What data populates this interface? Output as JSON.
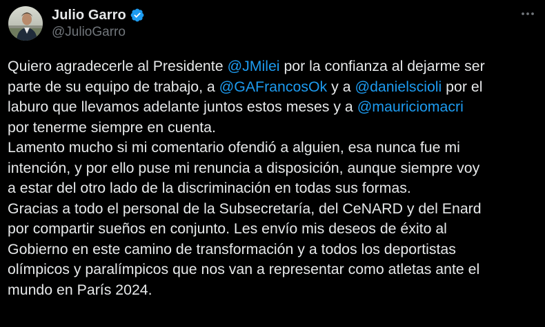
{
  "author": {
    "display_name": "Julio Garro",
    "handle": "@JulioGarro",
    "verified_icon": "verified-badge-icon",
    "avatar_icon": "avatar"
  },
  "menu": {
    "more_icon": "more-options-icon"
  },
  "post": {
    "lines": [
      [
        {
          "text": "Quiero agradecerle al Presidente "
        },
        {
          "text": "@JMilei",
          "mention": true
        },
        {
          "text": " por la confianza al dejarme ser"
        }
      ],
      [
        {
          "text": "parte de su equipo de trabajo, a "
        },
        {
          "text": "@GAFrancosOk",
          "mention": true
        },
        {
          "text": " y a "
        },
        {
          "text": "@danielscioli",
          "mention": true
        },
        {
          "text": " por el"
        }
      ],
      [
        {
          "text": "laburo que llevamos adelante juntos estos meses y a "
        },
        {
          "text": "@mauriciomacri",
          "mention": true
        }
      ],
      [
        {
          "text": "por tenerme siempre en cuenta."
        }
      ],
      [
        {
          "text": "Lamento mucho si mi comentario ofendió a alguien, esa nunca fue mi"
        }
      ],
      [
        {
          "text": "intención, y por ello puse mi renuncia a disposición, aunque siempre voy"
        }
      ],
      [
        {
          "text": "a estar del otro lado de la discriminación en todas sus formas."
        }
      ],
      [
        {
          "text": "Gracias a todo el personal de la Subsecretaría, del CeNARD y del Enard"
        }
      ],
      [
        {
          "text": "por compartir sueños en conjunto. Les envío mis deseos de éxito al"
        }
      ],
      [
        {
          "text": "Gobierno en este camino de transformación y a todos los deportistas"
        }
      ],
      [
        {
          "text": "olímpicos y paralímpicos que nos van a representar como atletas ante el"
        }
      ],
      [
        {
          "text": "mundo en París 2024."
        }
      ]
    ]
  },
  "colors": {
    "background": "#000000",
    "text": "#e7e9ea",
    "secondary": "#71767b",
    "mention": "#1d9bf0",
    "verified": "#1d9bf0"
  }
}
